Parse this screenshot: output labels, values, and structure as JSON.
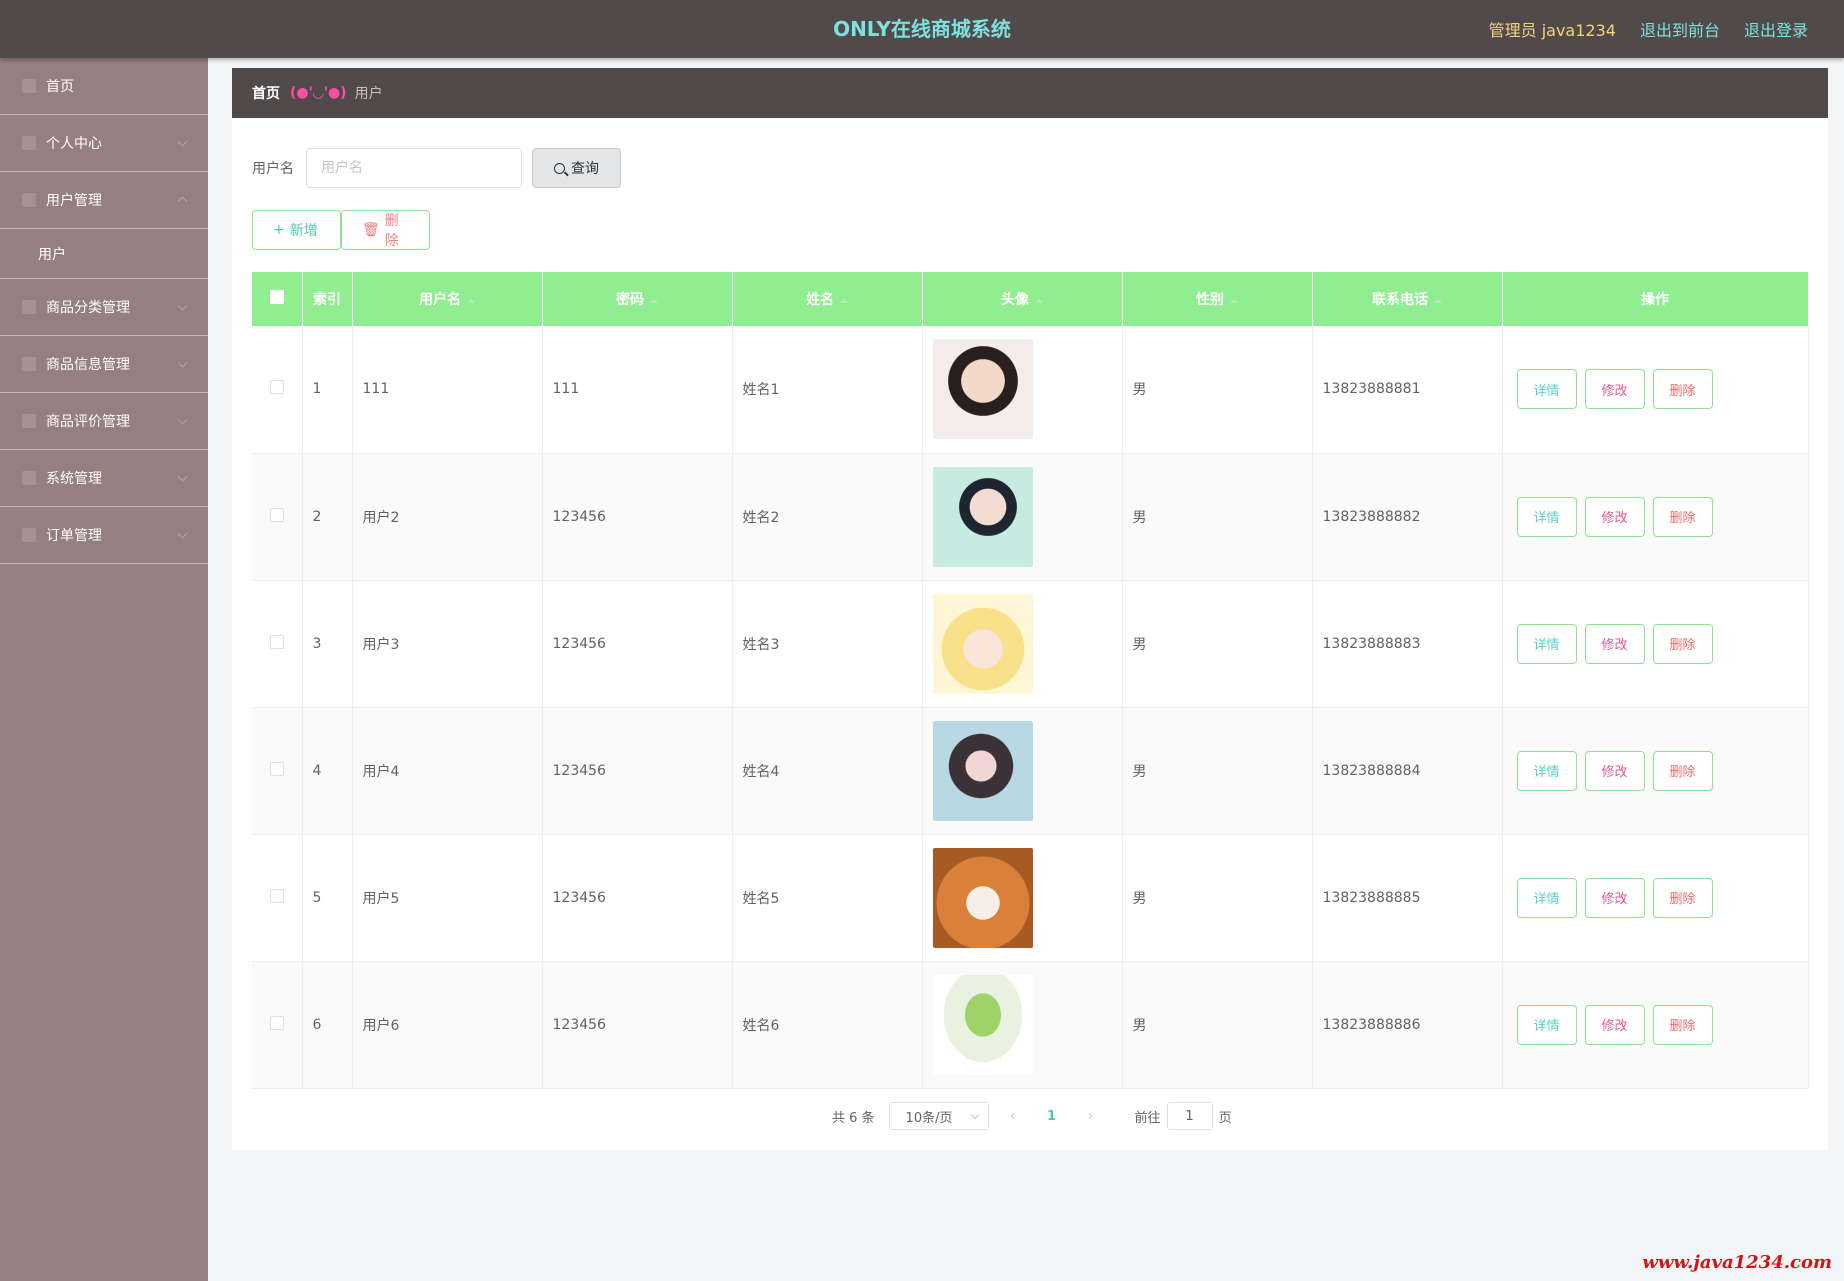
{
  "header": {
    "title": "ONLY在线商城系统",
    "admin_label": "管理员 java1234",
    "to_front": "退出到前台",
    "logout": "退出登录"
  },
  "sidebar": {
    "items": [
      {
        "label": "首页",
        "icon": "home-icon"
      },
      {
        "label": "个人中心",
        "icon": "user-icon"
      },
      {
        "label": "用户管理",
        "icon": "users-icon",
        "sub": "用户"
      },
      {
        "label": "商品分类管理",
        "icon": "category-icon"
      },
      {
        "label": "商品信息管理",
        "icon": "goods-icon"
      },
      {
        "label": "商品评价管理",
        "icon": "comment-icon"
      },
      {
        "label": "系统管理",
        "icon": "system-icon"
      },
      {
        "label": "订单管理",
        "icon": "order-icon"
      }
    ]
  },
  "breadcrumb": {
    "home": "首页",
    "face": "(●'◡'●)",
    "current": "用户"
  },
  "search": {
    "label": "用户名",
    "placeholder": "用户名",
    "button": "查询"
  },
  "actions": {
    "add": "新增",
    "delete": "删除"
  },
  "table": {
    "headers": [
      "索引",
      "用户名",
      "密码",
      "姓名",
      "头像",
      "性别",
      "联系电话",
      "操作"
    ],
    "rows": [
      {
        "index": "1",
        "username": "111",
        "password": "111",
        "name": "姓名1",
        "gender": "男",
        "phone": "13823888881"
      },
      {
        "index": "2",
        "username": "用户2",
        "password": "123456",
        "name": "姓名2",
        "gender": "男",
        "phone": "13823888882"
      },
      {
        "index": "3",
        "username": "用户3",
        "password": "123456",
        "name": "姓名3",
        "gender": "男",
        "phone": "13823888883"
      },
      {
        "index": "4",
        "username": "用户4",
        "password": "123456",
        "name": "姓名4",
        "gender": "男",
        "phone": "13823888884"
      },
      {
        "index": "5",
        "username": "用户5",
        "password": "123456",
        "name": "姓名5",
        "gender": "男",
        "phone": "13823888885"
      },
      {
        "index": "6",
        "username": "用户6",
        "password": "123456",
        "name": "姓名6",
        "gender": "男",
        "phone": "13823888886"
      }
    ],
    "op_detail": "详情",
    "op_edit": "修改",
    "op_delete": "删除"
  },
  "pagination": {
    "total": "共 6 条",
    "page_size": "10条/页",
    "current_page": "1",
    "goto_label": "前往",
    "goto_value": "1",
    "unit": "页"
  },
  "watermark": "www.java1234.com",
  "colors": {
    "topbar": "#504a4a",
    "sidebar": "#967f7f",
    "table_header": "#90ee90",
    "title": "#7fe0e0",
    "admin": "#f4d27a"
  }
}
